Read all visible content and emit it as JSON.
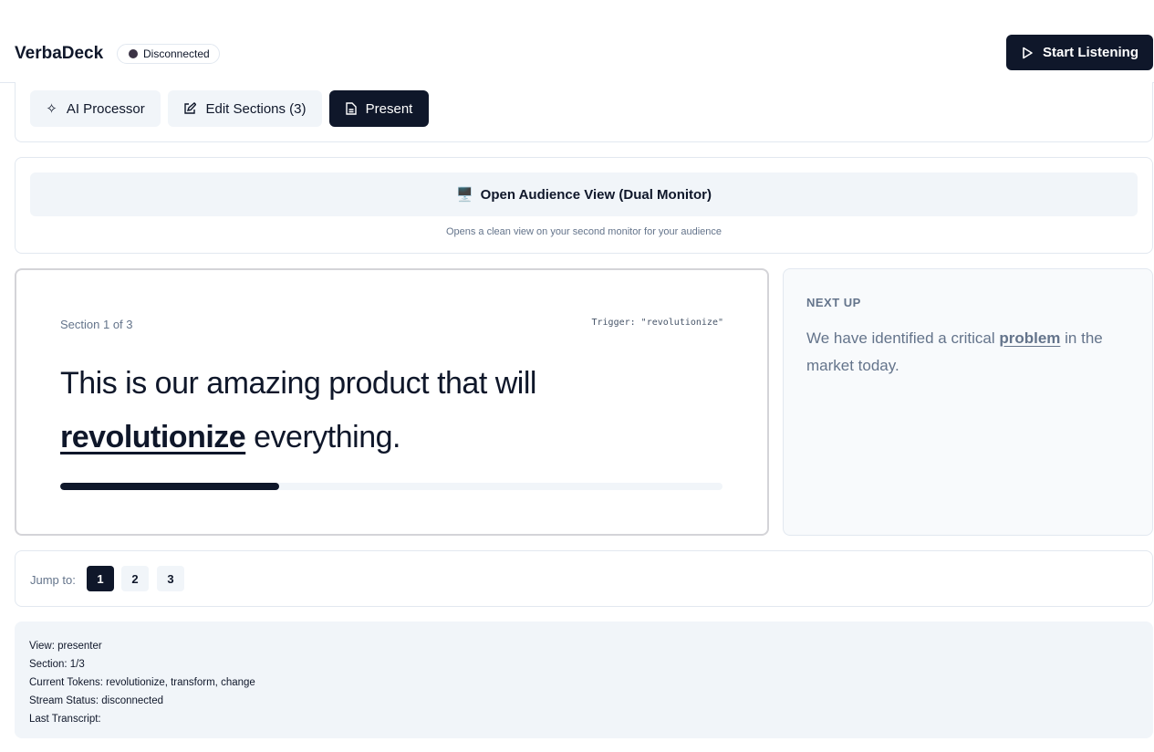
{
  "header": {
    "brand": "VerbaDeck",
    "status": "Disconnected",
    "start_button": "Start Listening"
  },
  "tabs": [
    {
      "label": "AI Processor",
      "icon": "sparkles-icon"
    },
    {
      "label": "Edit Sections (3)",
      "icon": "edit-icon"
    },
    {
      "label": "Present",
      "icon": "document-icon",
      "active": true
    }
  ],
  "audience": {
    "button": "Open Audience View (Dual Monitor)",
    "icon": "monitor-icon",
    "note": "Opens a clean view on your second monitor for your audience"
  },
  "current": {
    "section_label": "Section 1 of 3",
    "trigger": "Trigger: \"revolutionize\"",
    "text_before": "This is our amazing product that will ",
    "keyword": "revolutionize",
    "text_after": " everything.",
    "progress_percent": 33
  },
  "next": {
    "heading": "NEXT UP",
    "text_before": "We have identified a critical ",
    "keyword": "problem",
    "text_after": " in the market today."
  },
  "jump": {
    "label": "Jump to:",
    "pages": [
      "1",
      "2",
      "3"
    ],
    "active": "1"
  },
  "debug": [
    "View: presenter",
    "Section: 1/3",
    "Current Tokens: revolutionize, transform, change",
    "Stream Status: disconnected",
    "Last Transcript:"
  ]
}
